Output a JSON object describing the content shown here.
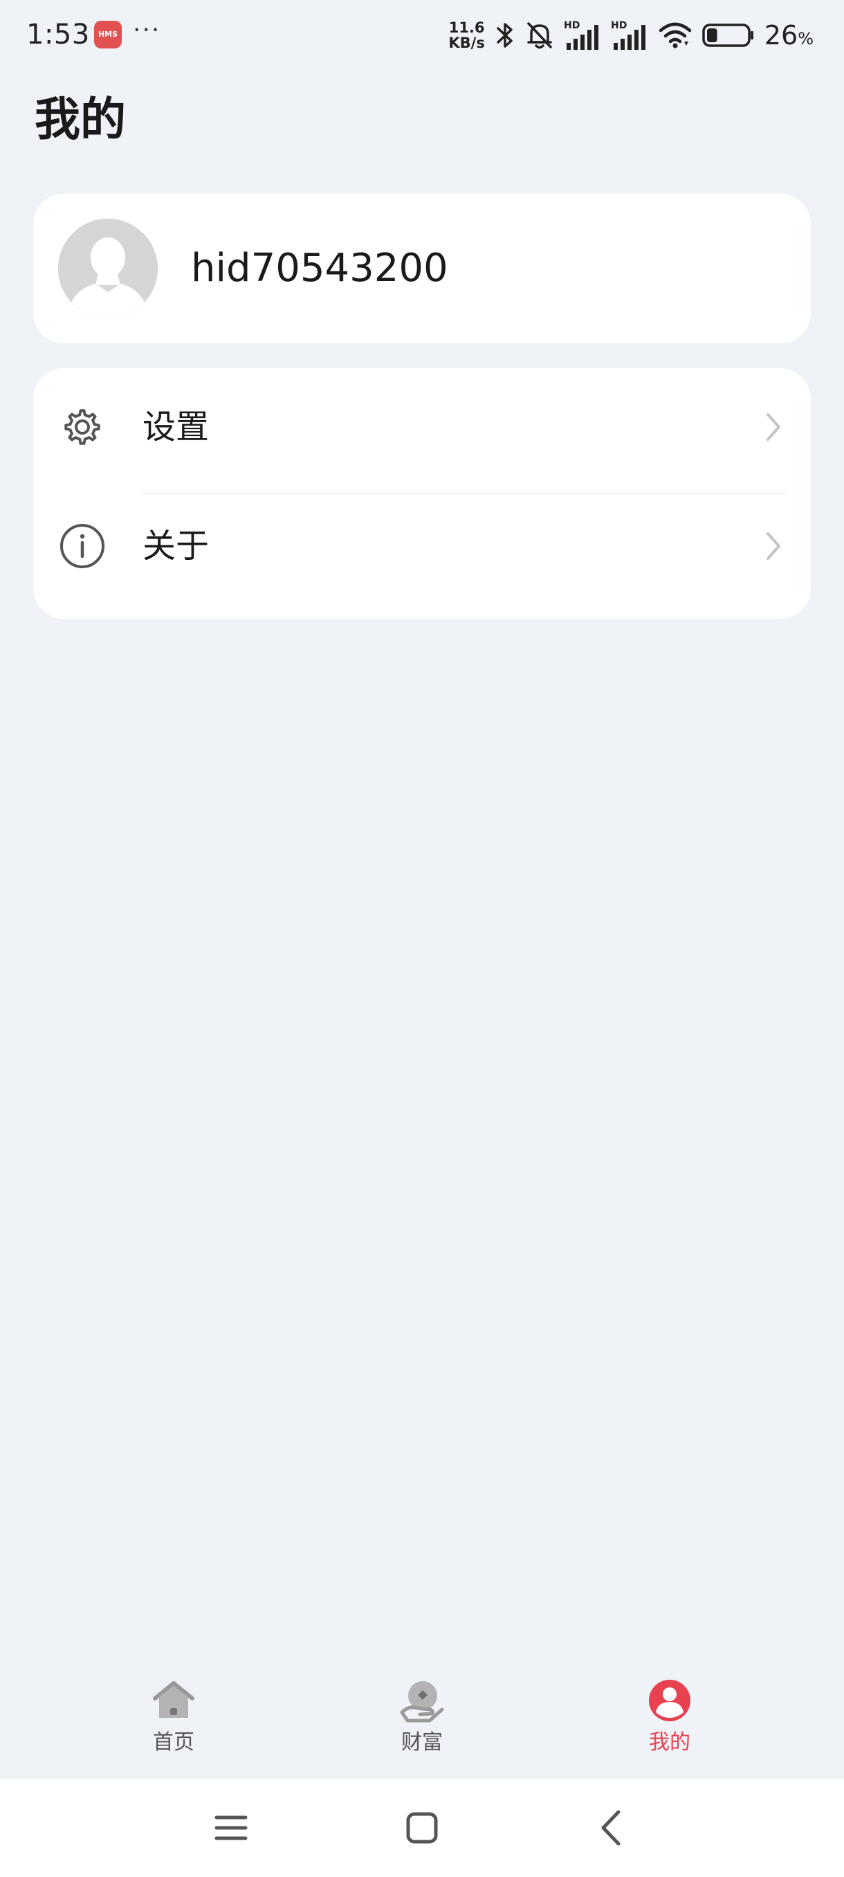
{
  "status_bar": {
    "time": "1:53",
    "hms_badge": "HMS",
    "more_dots": "···",
    "net_speed_value": "11.6",
    "net_speed_unit": "KB/s",
    "signal_label_1": "HD",
    "signal_label_2": "HD",
    "battery_value": "26",
    "battery_unit": "%",
    "battery_level": 0.26,
    "icons": [
      "bluetooth-icon",
      "bell-off-icon",
      "signal-icon",
      "wifi-icon",
      "battery-icon"
    ]
  },
  "page": {
    "title": "我的"
  },
  "profile": {
    "username": "hid70543200"
  },
  "menu": {
    "items": [
      {
        "label": "设置",
        "icon": "gear-icon"
      },
      {
        "label": "关于",
        "icon": "info-icon"
      }
    ]
  },
  "tab_bar": {
    "active": "mine",
    "accent_color": "#e8414f",
    "tabs": [
      {
        "key": "home",
        "label": "首页",
        "icon": "home-icon"
      },
      {
        "key": "wealth",
        "label": "财富",
        "icon": "wealth-icon"
      },
      {
        "key": "mine",
        "label": "我的",
        "icon": "profile-icon"
      }
    ]
  },
  "nav_bar": {
    "buttons": [
      "menu-icon",
      "home-square-icon",
      "back-icon"
    ]
  }
}
